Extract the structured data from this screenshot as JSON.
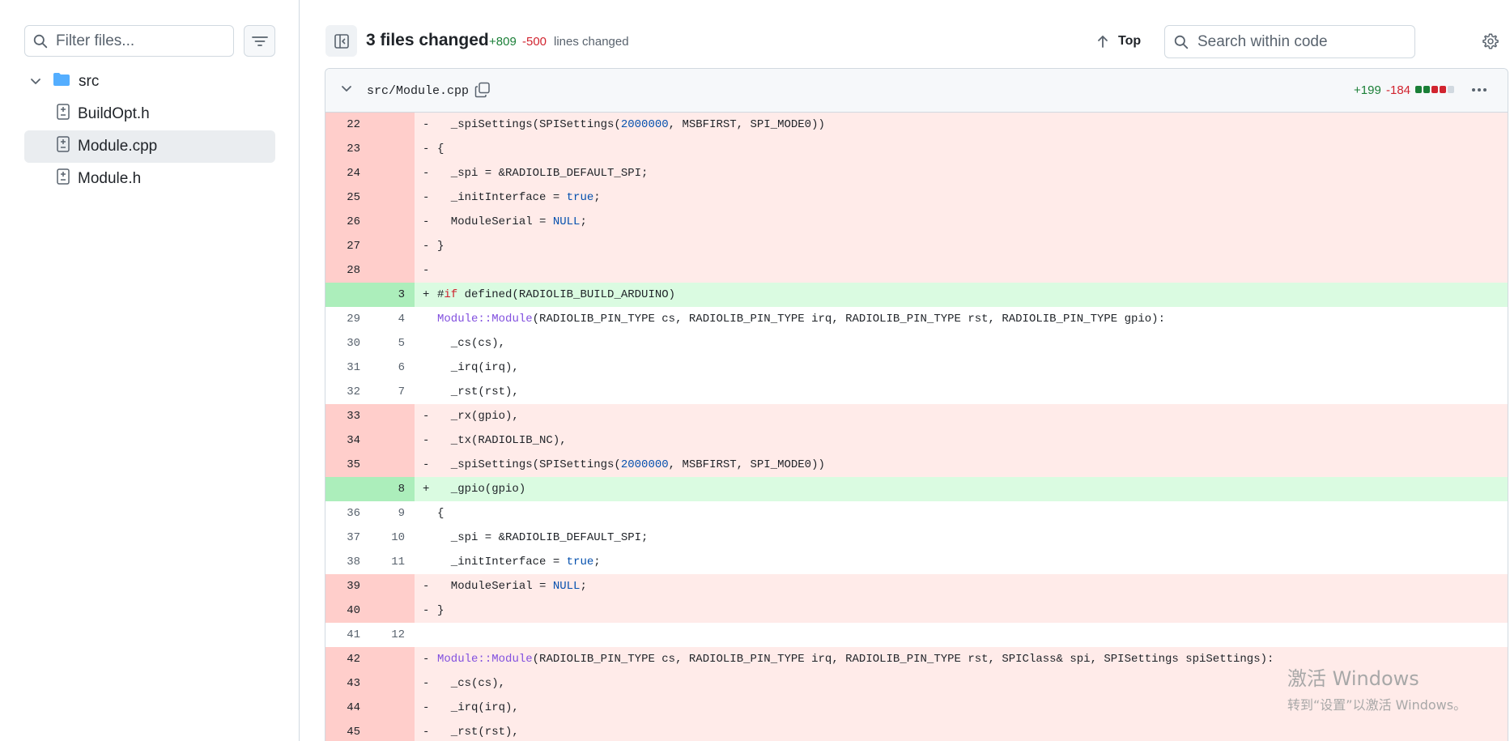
{
  "sidebar": {
    "filter_placeholder": "Filter files...",
    "tree": {
      "folder": "src",
      "files": [
        {
          "name": "BuildOpt.h",
          "selected": false
        },
        {
          "name": "Module.cpp",
          "selected": true
        },
        {
          "name": "Module.h",
          "selected": false
        }
      ]
    }
  },
  "summary": {
    "title": "3 files changed",
    "additions": "+809",
    "deletions": "-500",
    "lines_label": "lines changed"
  },
  "toolbar": {
    "top_label": "Top",
    "search_placeholder": "Search within code"
  },
  "file": {
    "path": "src/Module.cpp",
    "additions": "+199",
    "deletions": "-184",
    "diffstat_blocks": [
      "add",
      "add",
      "del",
      "del",
      "neutral"
    ]
  },
  "colors": {
    "add_text": "#1a7f37",
    "del_text": "#d1242f",
    "del_num_bg": "#ffcecb",
    "del_code_bg": "#ffebe9",
    "add_num_bg": "#aceebb",
    "add_code_bg": "#dafbe1"
  },
  "diff_lines": [
    {
      "type": "del",
      "old": "22",
      "new": "",
      "sign": "-",
      "code": "  _spiSettings(SPISettings(2000000, MSBFIRST, SPI_MODE0))"
    },
    {
      "type": "del",
      "old": "23",
      "new": "",
      "sign": "-",
      "code": "{"
    },
    {
      "type": "del",
      "old": "24",
      "new": "",
      "sign": "-",
      "code": "  _spi = &RADIOLIB_DEFAULT_SPI;"
    },
    {
      "type": "del",
      "old": "25",
      "new": "",
      "sign": "-",
      "code": "  _initInterface = true;"
    },
    {
      "type": "del",
      "old": "26",
      "new": "",
      "sign": "-",
      "code": "  ModuleSerial = NULL;"
    },
    {
      "type": "del",
      "old": "27",
      "new": "",
      "sign": "-",
      "code": "}"
    },
    {
      "type": "del",
      "old": "28",
      "new": "",
      "sign": "-",
      "code": ""
    },
    {
      "type": "add",
      "old": "",
      "new": "3",
      "sign": "+",
      "code": "#if defined(RADIOLIB_BUILD_ARDUINO)"
    },
    {
      "type": "ctx",
      "old": "29",
      "new": "4",
      "sign": "",
      "code": "Module::Module(RADIOLIB_PIN_TYPE cs, RADIOLIB_PIN_TYPE irq, RADIOLIB_PIN_TYPE rst, RADIOLIB_PIN_TYPE gpio):"
    },
    {
      "type": "ctx",
      "old": "30",
      "new": "5",
      "sign": "",
      "code": "  _cs(cs),"
    },
    {
      "type": "ctx",
      "old": "31",
      "new": "6",
      "sign": "",
      "code": "  _irq(irq),"
    },
    {
      "type": "ctx",
      "old": "32",
      "new": "7",
      "sign": "",
      "code": "  _rst(rst),"
    },
    {
      "type": "del",
      "old": "33",
      "new": "",
      "sign": "-",
      "code": "  _rx(gpio),"
    },
    {
      "type": "del",
      "old": "34",
      "new": "",
      "sign": "-",
      "code": "  _tx(RADIOLIB_NC),"
    },
    {
      "type": "del",
      "old": "35",
      "new": "",
      "sign": "-",
      "code": "  _spiSettings(SPISettings(2000000, MSBFIRST, SPI_MODE0))"
    },
    {
      "type": "add",
      "old": "",
      "new": "8",
      "sign": "+",
      "code": "  _gpio(gpio)"
    },
    {
      "type": "ctx",
      "old": "36",
      "new": "9",
      "sign": "",
      "code": "{"
    },
    {
      "type": "ctx",
      "old": "37",
      "new": "10",
      "sign": "",
      "code": "  _spi = &RADIOLIB_DEFAULT_SPI;"
    },
    {
      "type": "ctx",
      "old": "38",
      "new": "11",
      "sign": "",
      "code": "  _initInterface = true;"
    },
    {
      "type": "del",
      "old": "39",
      "new": "",
      "sign": "-",
      "code": "  ModuleSerial = NULL;"
    },
    {
      "type": "del",
      "old": "40",
      "new": "",
      "sign": "-",
      "code": "}"
    },
    {
      "type": "ctx",
      "old": "41",
      "new": "12",
      "sign": "",
      "code": ""
    },
    {
      "type": "del",
      "old": "42",
      "new": "",
      "sign": "-",
      "code": "Module::Module(RADIOLIB_PIN_TYPE cs, RADIOLIB_PIN_TYPE irq, RADIOLIB_PIN_TYPE rst, SPIClass& spi, SPISettings spiSettings):"
    },
    {
      "type": "del",
      "old": "43",
      "new": "",
      "sign": "-",
      "code": "  _cs(cs),"
    },
    {
      "type": "del",
      "old": "44",
      "new": "",
      "sign": "-",
      "code": "  _irq(irq),"
    },
    {
      "type": "del",
      "old": "45",
      "new": "",
      "sign": "-",
      "code": "  _rst(rst),"
    }
  ],
  "watermark": {
    "line1": "激活 Windows",
    "line2": "转到“设置”以激活 Windows。"
  }
}
